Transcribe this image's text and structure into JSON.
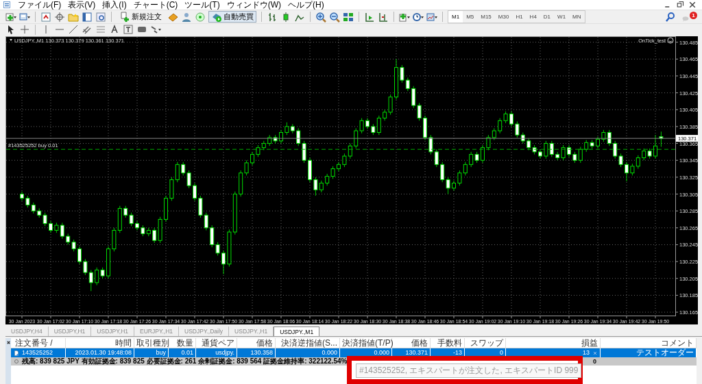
{
  "menu": [
    {
      "label": "ファイル(F)"
    },
    {
      "label": "表示(V)"
    },
    {
      "label": "挿入(I)"
    },
    {
      "label": "チャート(C)"
    },
    {
      "label": "ツール(T)"
    },
    {
      "label": "ウィンドウ(W)"
    },
    {
      "label": "ヘルプ(H)"
    }
  ],
  "toolbar": {
    "new_order": {
      "label": "新規注文"
    },
    "auto_trading": {
      "label": "自動売買",
      "on": true
    },
    "timeframes": [
      {
        "label": "M1",
        "selected": true
      },
      {
        "label": "M5",
        "selected": false
      },
      {
        "label": "M15",
        "selected": false
      },
      {
        "label": "M30",
        "selected": false
      },
      {
        "label": "H1",
        "selected": false
      },
      {
        "label": "H4",
        "selected": false
      },
      {
        "label": "D1",
        "selected": false
      },
      {
        "label": "W1",
        "selected": false
      },
      {
        "label": "MN",
        "selected": false
      }
    ],
    "notifications": {
      "count": "1"
    }
  },
  "chart": {
    "symbol_info": "USDJPY.,M1  130.373 130.379 130.361 130.371",
    "expert": "OnTick_test",
    "chart_data": {
      "type": "candlestick",
      "categories": [
        "30 Jan 2023",
        null,
        null,
        null,
        null,
        "30 Jan 17:02",
        null,
        null,
        null,
        null,
        "30 Jan 17:10",
        null,
        null,
        null,
        null,
        "30 Jan 17:18",
        null,
        null,
        null,
        null,
        "30 Jan 17:26",
        null,
        null,
        null,
        null,
        "30 Jan 17:34",
        null,
        null,
        null,
        null,
        "30 Jan 17:42",
        null,
        null,
        null,
        null,
        "30 Jan 17:50",
        null,
        null,
        null,
        null,
        "30 Jan 17:58",
        null,
        null,
        null,
        null,
        "30 Jan 18:06",
        null,
        null,
        null,
        null,
        "30 Jan 18:14",
        null,
        null,
        null,
        null,
        "30 Jan 18:22",
        null,
        null,
        null,
        null,
        "30 Jan 18:30",
        null,
        null,
        null,
        null,
        "30 Jan 18:38",
        null,
        null,
        null,
        null,
        "30 Jan 18:46",
        null,
        null,
        null,
        null,
        "30 Jan 18:54",
        null,
        null,
        null,
        null,
        "30 Jan 19:02",
        null,
        null,
        null,
        null,
        "30 Jan 19:10",
        null,
        null,
        null,
        null,
        "30 Jan 19:18",
        null,
        null,
        null,
        null,
        "30 Jan 19:26",
        null,
        null,
        null,
        null,
        "30 Jan 19:34",
        null,
        null,
        null,
        null,
        "30 Jan 19:42",
        null,
        null,
        null,
        null,
        "30 Jan 19:50",
        null
      ],
      "ylim": [
        130.161,
        130.492
      ],
      "grid": true,
      "ref_lines": [
        {
          "axis": "y",
          "value": 130.358,
          "label": "#143525252 buy 0.01"
        },
        {
          "axis": "y",
          "value": 130.371,
          "label": "130.371"
        }
      ],
      "yticks": [
        {
          "value": 130.485,
          "label": "130.485"
        },
        {
          "value": 130.465,
          "label": "130.465"
        },
        {
          "value": 130.445,
          "label": "130.445"
        },
        {
          "value": 130.425,
          "label": "130.425"
        },
        {
          "value": 130.405,
          "label": "130.405"
        },
        {
          "value": 130.385,
          "label": "130.385"
        },
        {
          "value": 130.365,
          "label": "130.365"
        },
        {
          "value": 130.345,
          "label": "130.345"
        },
        {
          "value": 130.325,
          "label": "130.325"
        },
        {
          "value": 130.305,
          "label": "130.305"
        },
        {
          "value": 130.285,
          "label": "130.285"
        },
        {
          "value": 130.265,
          "label": "130.265"
        },
        {
          "value": 130.245,
          "label": "130.245"
        },
        {
          "value": 130.225,
          "label": "130.225"
        },
        {
          "value": 130.205,
          "label": "130.205"
        },
        {
          "value": 130.185,
          "label": "130.185"
        },
        {
          "value": 130.165,
          "label": "130.165"
        }
      ],
      "ohlc": [
        [
          130.305,
          130.308,
          130.297,
          130.3
        ],
        [
          130.3,
          130.303,
          130.289,
          130.292
        ],
        [
          130.292,
          130.295,
          130.282,
          130.285
        ],
        [
          130.285,
          130.288,
          130.277,
          130.28
        ],
        [
          130.28,
          130.283,
          130.267,
          130.27
        ],
        [
          130.27,
          130.273,
          130.259,
          130.262
        ],
        [
          130.262,
          130.271,
          130.259,
          130.268
        ],
        [
          130.268,
          130.271,
          130.252,
          130.255
        ],
        [
          130.255,
          130.258,
          130.245,
          130.248
        ],
        [
          130.248,
          130.251,
          130.237,
          130.24
        ],
        [
          130.24,
          130.243,
          130.222,
          130.225
        ],
        [
          130.225,
          130.228,
          130.209,
          130.212
        ],
        [
          130.212,
          130.215,
          130.19,
          130.2
        ],
        [
          130.2,
          130.218,
          130.197,
          130.215
        ],
        [
          130.215,
          130.218,
          130.205,
          130.208
        ],
        [
          130.208,
          130.243,
          130.205,
          130.24
        ],
        [
          130.24,
          130.265,
          130.237,
          130.262
        ],
        [
          130.262,
          130.291,
          130.259,
          130.288
        ],
        [
          130.288,
          130.291,
          130.277,
          130.28
        ],
        [
          130.28,
          130.283,
          130.267,
          130.27
        ],
        [
          130.27,
          130.273,
          130.262,
          130.265
        ],
        [
          130.265,
          130.268,
          130.255,
          130.258
        ],
        [
          130.258,
          130.265,
          130.255,
          130.262
        ],
        [
          130.262,
          130.265,
          130.247,
          130.25
        ],
        [
          130.25,
          130.278,
          130.247,
          130.275
        ],
        [
          130.275,
          130.303,
          130.272,
          130.3
        ],
        [
          130.3,
          130.325,
          130.297,
          130.322
        ],
        [
          130.322,
          130.343,
          130.319,
          130.34
        ],
        [
          130.34,
          130.343,
          130.327,
          130.33
        ],
        [
          130.33,
          130.333,
          130.312,
          130.315
        ],
        [
          130.315,
          130.318,
          130.297,
          130.3
        ],
        [
          130.3,
          130.303,
          130.277,
          130.28
        ],
        [
          130.28,
          130.283,
          130.262,
          130.265
        ],
        [
          130.265,
          130.268,
          130.242,
          130.245
        ],
        [
          130.245,
          130.248,
          130.232,
          130.235
        ],
        [
          130.235,
          130.238,
          130.21,
          130.222
        ],
        [
          130.222,
          130.263,
          130.219,
          130.26
        ],
        [
          130.26,
          130.308,
          130.257,
          130.305
        ],
        [
          130.305,
          130.333,
          130.302,
          130.33
        ],
        [
          130.33,
          130.345,
          130.327,
          130.342
        ],
        [
          130.342,
          130.355,
          130.339,
          130.352
        ],
        [
          130.352,
          130.363,
          130.349,
          130.36
        ],
        [
          130.36,
          130.368,
          130.357,
          130.365
        ],
        [
          130.365,
          130.375,
          130.362,
          130.372
        ],
        [
          130.372,
          130.375,
          130.365,
          130.368
        ],
        [
          130.368,
          130.381,
          130.365,
          130.378
        ],
        [
          130.378,
          130.39,
          130.375,
          130.385
        ],
        [
          130.385,
          130.388,
          130.377,
          130.38
        ],
        [
          130.38,
          130.383,
          130.362,
          130.365
        ],
        [
          130.365,
          130.368,
          130.342,
          130.345
        ],
        [
          130.345,
          130.348,
          130.319,
          130.322
        ],
        [
          130.322,
          130.325,
          130.303,
          130.31
        ],
        [
          130.31,
          130.321,
          130.307,
          130.318
        ],
        [
          130.318,
          130.329,
          130.315,
          130.326
        ],
        [
          130.326,
          130.338,
          130.323,
          130.335
        ],
        [
          130.335,
          130.343,
          130.332,
          130.34
        ],
        [
          130.34,
          130.353,
          130.337,
          130.35
        ],
        [
          130.35,
          130.365,
          130.347,
          130.362
        ],
        [
          130.362,
          130.383,
          130.359,
          130.38
        ],
        [
          130.38,
          130.395,
          130.377,
          130.392
        ],
        [
          130.392,
          130.395,
          130.382,
          130.385
        ],
        [
          130.385,
          130.388,
          130.375,
          130.378
        ],
        [
          130.378,
          130.398,
          130.375,
          130.395
        ],
        [
          130.395,
          130.405,
          130.392,
          130.402
        ],
        [
          130.402,
          130.423,
          130.399,
          130.42
        ],
        [
          130.42,
          130.465,
          130.417,
          130.455
        ],
        [
          130.455,
          130.458,
          130.437,
          130.44
        ],
        [
          130.44,
          130.443,
          130.427,
          130.43
        ],
        [
          130.43,
          130.433,
          130.407,
          130.41
        ],
        [
          130.41,
          130.413,
          130.392,
          130.395
        ],
        [
          130.395,
          130.398,
          130.369,
          130.372
        ],
        [
          130.372,
          130.375,
          130.352,
          130.355
        ],
        [
          130.355,
          130.358,
          130.337,
          130.34
        ],
        [
          130.34,
          130.343,
          130.319,
          130.322
        ],
        [
          130.322,
          130.325,
          130.305,
          130.312
        ],
        [
          130.312,
          130.321,
          130.309,
          130.318
        ],
        [
          130.318,
          130.333,
          130.315,
          130.33
        ],
        [
          130.33,
          130.343,
          130.327,
          130.34
        ],
        [
          130.34,
          130.355,
          130.337,
          130.352
        ],
        [
          130.352,
          130.355,
          130.342,
          130.345
        ],
        [
          130.345,
          130.363,
          130.342,
          130.36
        ],
        [
          130.36,
          130.375,
          130.357,
          130.372
        ],
        [
          130.372,
          130.383,
          130.369,
          130.38
        ],
        [
          130.38,
          130.395,
          130.377,
          130.392
        ],
        [
          130.392,
          130.403,
          130.389,
          130.4
        ],
        [
          130.4,
          130.403,
          130.385,
          130.388
        ],
        [
          130.388,
          130.391,
          130.372,
          130.375
        ],
        [
          130.375,
          130.378,
          130.365,
          130.368
        ],
        [
          130.368,
          130.371,
          130.357,
          130.36
        ],
        [
          130.36,
          130.363,
          130.352,
          130.355
        ],
        [
          130.355,
          130.358,
          130.347,
          130.35
        ],
        [
          130.35,
          130.368,
          130.347,
          130.365
        ],
        [
          130.365,
          130.368,
          130.349,
          130.352
        ],
        [
          130.352,
          130.355,
          130.345,
          130.348
        ],
        [
          130.348,
          130.363,
          130.345,
          130.36
        ],
        [
          130.36,
          130.363,
          130.349,
          130.352
        ],
        [
          130.352,
          130.355,
          130.342,
          130.345
        ],
        [
          130.345,
          130.361,
          130.342,
          130.358
        ],
        [
          130.358,
          130.369,
          130.355,
          130.366
        ],
        [
          130.366,
          130.369,
          130.359,
          130.362
        ],
        [
          130.362,
          130.373,
          130.359,
          130.37
        ],
        [
          130.37,
          130.381,
          130.367,
          130.378
        ],
        [
          130.378,
          130.381,
          130.362,
          130.365
        ],
        [
          130.365,
          130.368,
          130.347,
          130.35
        ],
        [
          130.35,
          130.353,
          130.337,
          130.34
        ],
        [
          130.34,
          130.343,
          130.32,
          130.33
        ],
        [
          130.33,
          130.341,
          130.327,
          130.338
        ],
        [
          130.338,
          130.351,
          130.335,
          130.348
        ],
        [
          130.348,
          130.359,
          130.345,
          130.356
        ],
        [
          130.356,
          130.359,
          130.347,
          130.35
        ],
        [
          130.35,
          130.375,
          130.347,
          130.362
        ],
        [
          130.373,
          130.379,
          130.361,
          130.371
        ]
      ]
    }
  },
  "tabs": [
    {
      "label": "USDJPY,H4",
      "selected": false
    },
    {
      "label": "USDJPY,H1",
      "selected": false
    },
    {
      "label": "USDJPY,H1",
      "selected": false
    },
    {
      "label": "EURJPY.,H1",
      "selected": false
    },
    {
      "label": "USDJPY.,Daily",
      "selected": false
    },
    {
      "label": "USDJPY.,H1",
      "selected": false
    },
    {
      "label": "USDJPY.,M1",
      "selected": true
    }
  ],
  "terminal": {
    "columns": [
      "注文番号 /",
      "時間",
      "取引種別",
      "数量",
      "通貨ペア",
      "価格",
      "決済逆指値(S...",
      "決済指値(T/P)",
      "価格",
      "手数料",
      "スワップ",
      "損益",
      "コメント"
    ],
    "rows": [
      {
        "selected": true,
        "cells": [
          "143525252",
          "2023.01.30 19:48:08",
          "buy",
          "0.01",
          "usdjpy.",
          "130.358",
          "0.000",
          "0.000",
          "130.371",
          "-13",
          "0",
          "13",
          "テストオーダー"
        ]
      }
    ],
    "balance": {
      "text": "残高: 839 825 JPY  有効証拠金: 839 825  必要証拠金: 261  余剰証拠金: 839 564  証拠金維持率: 322122.54%",
      "profit": "0"
    },
    "tooltip": {
      "text": "#143525252, エキスパートが注文した, エキスパートID 999"
    }
  }
}
